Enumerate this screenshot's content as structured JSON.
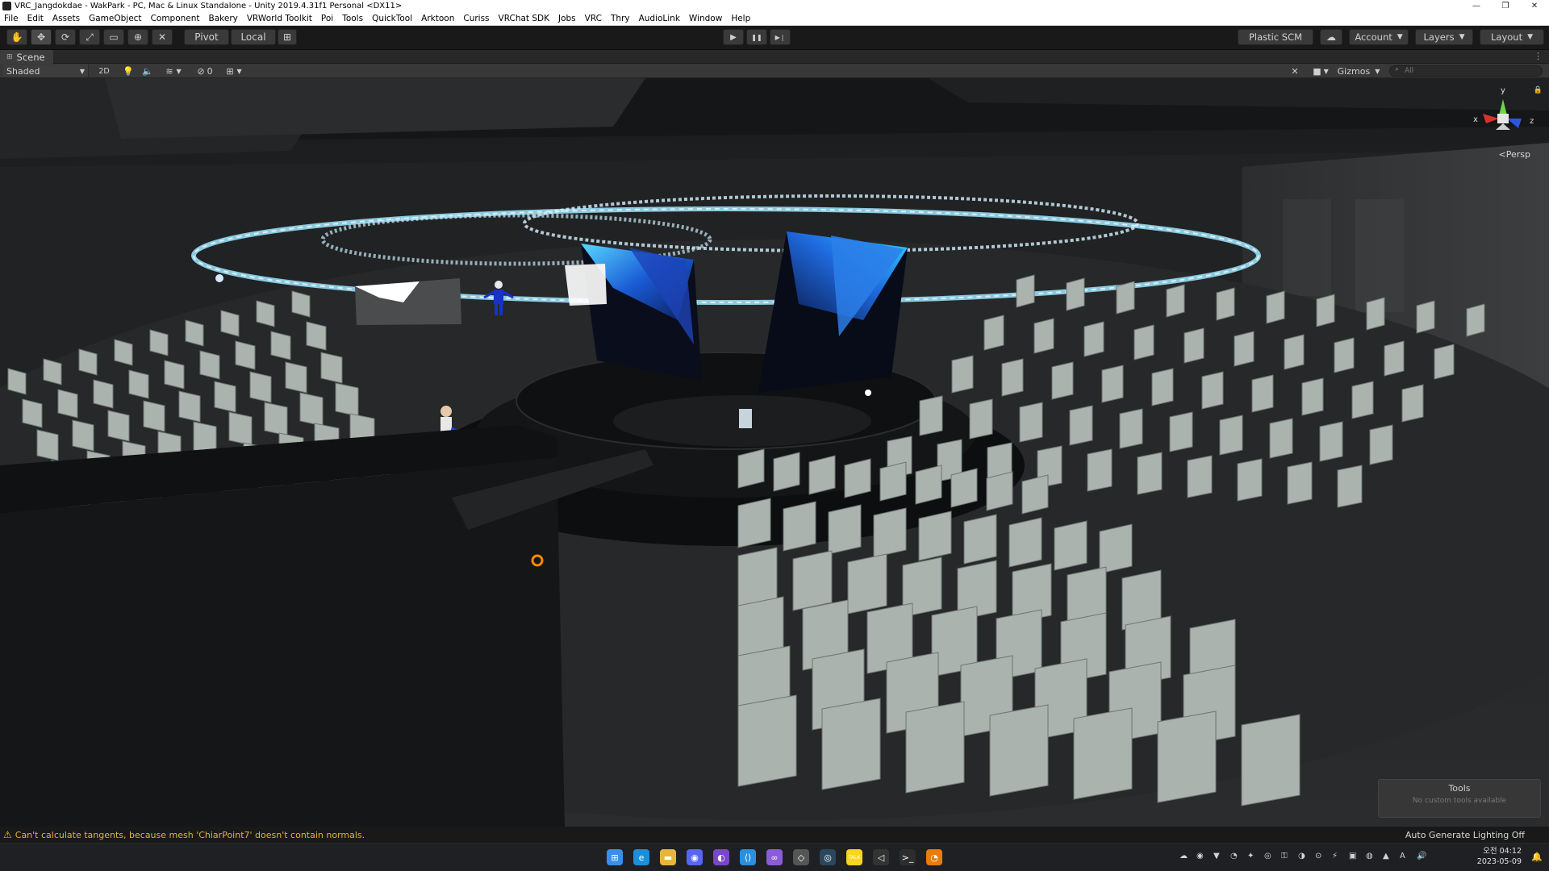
{
  "window": {
    "title": "VRC_Jangdokdae - WakPark - PC, Mac & Linux Standalone - Unity 2019.4.31f1 Personal <DX11>",
    "controls": [
      "—",
      "❐",
      "✕"
    ]
  },
  "menu": [
    "File",
    "Edit",
    "Assets",
    "GameObject",
    "Component",
    "Bakery",
    "VRWorld Toolkit",
    "Poi",
    "Tools",
    "QuickTool",
    "Arktoon",
    "Curiss",
    "VRChat SDK",
    "Jobs",
    "VRC",
    "Thry",
    "AudioLink",
    "Window",
    "Help"
  ],
  "toolbar": {
    "tools": [
      {
        "name": "hand-tool-icon",
        "glyph": "✋"
      },
      {
        "name": "move-tool-icon",
        "glyph": "✥"
      },
      {
        "name": "rotate-tool-icon",
        "glyph": "⟳"
      },
      {
        "name": "scale-tool-icon",
        "glyph": "⤢"
      },
      {
        "name": "rect-tool-icon",
        "glyph": "▭"
      },
      {
        "name": "transform-tool-icon",
        "glyph": "⊕"
      },
      {
        "name": "custom-tool-icon",
        "glyph": "✕"
      }
    ],
    "pivot_label": "Pivot",
    "local_label": "Local",
    "grid_snap_glyph": "⊞",
    "play_glyph": "▶",
    "pause_glyph": "❚❚",
    "step_glyph": "▶❘",
    "plastic_label": "Plastic SCM",
    "cloud_glyph": "☁",
    "account_label": "Account",
    "layers_label": "Layers",
    "layout_label": "Layout"
  },
  "scene_tab": {
    "label": "Scene",
    "shading_mode": "Shaded",
    "mode_2d": "2D",
    "hidden_count": "0",
    "gizmos_label": "Gizmos",
    "search_placeholder": "All"
  },
  "viewport": {
    "projection": "Persp",
    "axes": {
      "x": "x",
      "y": "y",
      "z": "z"
    },
    "tools_panel_title": "Tools",
    "tools_panel_message": "No custom tools available"
  },
  "status": {
    "warning": "Can't calculate tangents, because mesh 'ChiarPoint7' doesn't contain normals.",
    "lighting": "Auto Generate Lighting Off"
  },
  "taskbar": {
    "apps": [
      {
        "name": "start-button",
        "glyph": "⊞",
        "color": "#3b8ee8"
      },
      {
        "name": "edge-icon",
        "glyph": "e",
        "color": "#1c8fd8"
      },
      {
        "name": "file-explorer-icon",
        "glyph": "▬",
        "color": "#e7b53a"
      },
      {
        "name": "discord-icon",
        "glyph": "◉",
        "color": "#5865f2"
      },
      {
        "name": "github-desktop-icon",
        "glyph": "◐",
        "color": "#7b46c9"
      },
      {
        "name": "vscode-icon",
        "glyph": "⟨⟩",
        "color": "#2b8fe0"
      },
      {
        "name": "visual-studio-icon",
        "glyph": "∞",
        "color": "#8a5cd6"
      },
      {
        "name": "unity-hub-icon",
        "glyph": "◇",
        "color": "#555"
      },
      {
        "name": "steam-icon",
        "glyph": "◎",
        "color": "#2a475e"
      },
      {
        "name": "kakaotalk-icon",
        "glyph": "TALK",
        "color": "#f7d520"
      },
      {
        "name": "unity-editor-icon",
        "glyph": "◁",
        "color": "#333"
      },
      {
        "name": "terminal-icon",
        "glyph": ">_",
        "color": "#2d2d2d"
      },
      {
        "name": "blender-icon",
        "glyph": "◔",
        "color": "#e87d0d"
      }
    ],
    "tray_glyphs": [
      "☁",
      "◉",
      "▼",
      "◔",
      "✦",
      "◎",
      "⚿",
      "◑",
      "⊙",
      "⚡",
      "▣",
      "◍",
      "▲",
      "A",
      "🔊"
    ],
    "time": "오전 04:12",
    "date": "2023-05-09"
  },
  "colors": {
    "title_bg": "#ffffff",
    "editor_bg": "#191919",
    "toolbar_button": "#3a3a3a",
    "warning": "#e3b33a",
    "neon_ring": "#9fe6ff",
    "screen_blue": "#1a5bd6",
    "seat": "#aab3ad"
  }
}
